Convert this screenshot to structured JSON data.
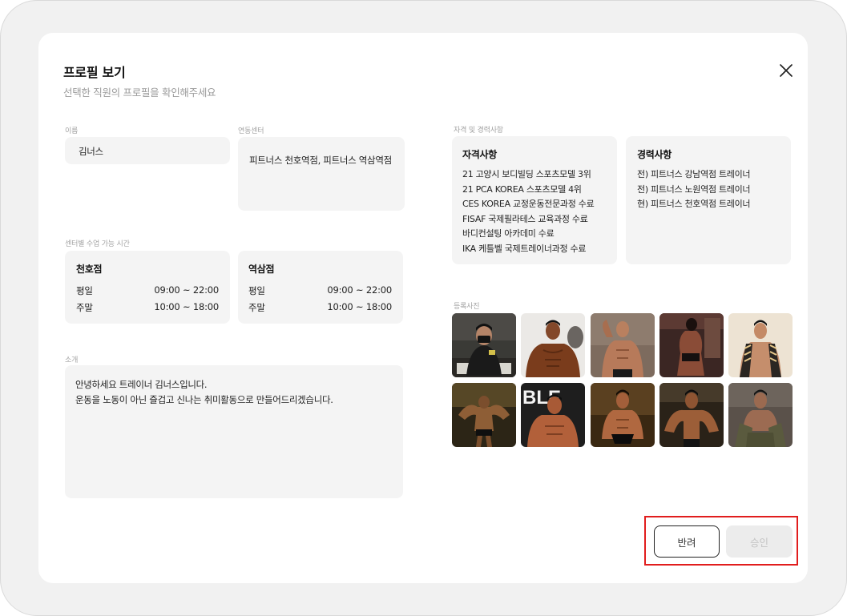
{
  "modal": {
    "title": "프로필 보기",
    "subtitle": "선택한 직원의 프로필을 확인해주세요",
    "close_icon": "close-icon"
  },
  "profile": {
    "name_label": "이름",
    "name_value": "김너스",
    "center_label": "연동센터",
    "center_value": "피트너스 천호역점, 피트너스 역삼역점"
  },
  "availability": {
    "label": "센터별 수업 가능 시간",
    "centers": [
      {
        "name": "천호점",
        "rows": [
          {
            "day": "평일",
            "time": "09:00 ~ 22:00"
          },
          {
            "day": "주말",
            "time": "10:00 ~ 18:00"
          }
        ]
      },
      {
        "name": "역삼점",
        "rows": [
          {
            "day": "평일",
            "time": "09:00 ~ 22:00"
          },
          {
            "day": "주말",
            "time": "10:00 ~ 18:00"
          }
        ]
      }
    ]
  },
  "intro": {
    "label": "소개",
    "line1": "안녕하세요 트레이너 김너스입니다.",
    "line2": "운동을 노동이 아닌 즐겁고 신나는 취미활동으로 만들어드리겠습니다."
  },
  "qualifications": {
    "label": "자격 및 경력사항",
    "cert_title": "자격사항",
    "certs": [
      "21 고양시 보디빌딩 스포츠모델 3위",
      "21 PCA KOREA 스포츠모델 4위",
      "CES KOREA 교정운동전문과정 수료",
      "FISAF 국제필라테스 교육과정 수료",
      "바디컨설팅 아카데미 수료",
      "IKA 케틀벨 국제트레이너과정 수료"
    ],
    "career_title": "경력사항",
    "careers": [
      "전) 피트너스 강남역점 트레이너",
      "전) 피트너스 노원역점 트레이너",
      "현) 피트너스 천호역점 트레이너"
    ]
  },
  "photos": {
    "label": "등록사진",
    "sign_text": "BLE"
  },
  "actions": {
    "reject_label": "반려",
    "approve_label": "승인"
  },
  "colors": {
    "accent_highlight": "#e11d1d",
    "disabled_button_bg": "#ececec",
    "box_bg": "#f4f4f4"
  }
}
